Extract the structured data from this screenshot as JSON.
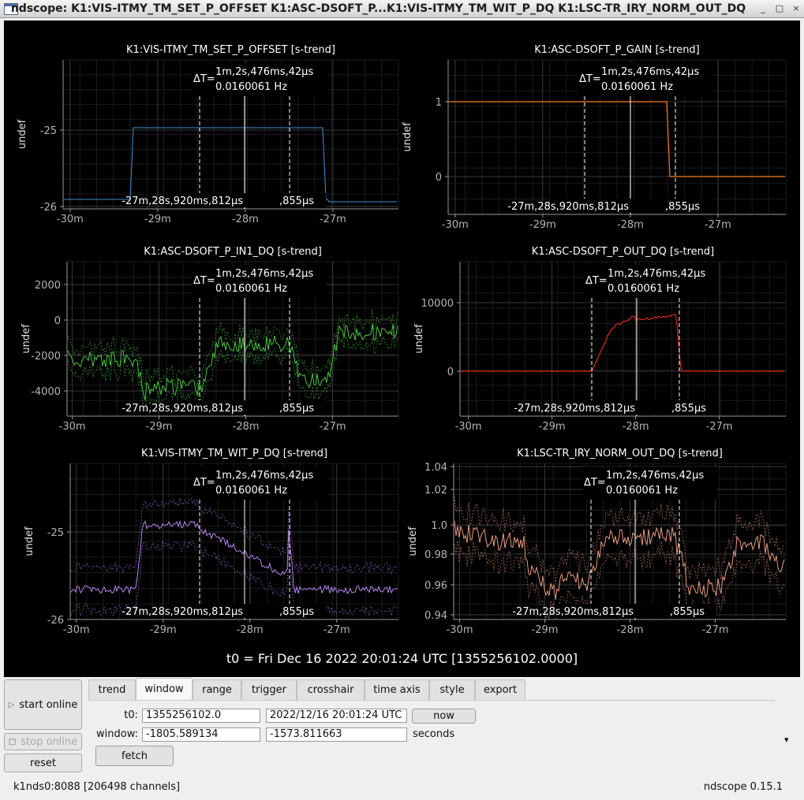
{
  "window": {
    "title": "ndscope: K1:VIS-ITMY_TM_SET_P_OFFSET K1:ASC-DSOFT_P...K1:VIS-ITMY_TM_WIT_P_DQ K1:LSC-TR_IRY_NORM_OUT_DQ",
    "minimize_glyph": "_",
    "maximize_glyph": "□",
    "close_glyph": "×"
  },
  "plots": [
    {
      "title": "K1:VIS-ITMY_TM_SET_P_OFFSET [s-trend]",
      "ylabel": "undef",
      "color": "#3d8fd8",
      "yticks": [
        "-25",
        "-26"
      ],
      "xticks": [
        "-30m",
        "-29m",
        "-28m",
        "-27m"
      ],
      "cursor_delta": "ΔT=",
      "cursor_dt": "1m,2s,476ms,42µs",
      "cursor_freq": "0.0160061 Hz",
      "cursor_t1": "-27m,28s,920ms,812µs",
      "cursor_t2": ",855µs"
    },
    {
      "title": "K1:ASC-DSOFT_P_GAIN [s-trend]",
      "ylabel": "undef",
      "color": "#ff7a1a",
      "yticks": [
        "1",
        "0"
      ],
      "xticks": [
        "-30m",
        "-29m",
        "-28m",
        "-27m"
      ],
      "cursor_delta": "ΔT=",
      "cursor_dt": "1m,2s,476ms,42µs",
      "cursor_freq": "0.0160061 Hz",
      "cursor_t1": "-27m,28s,920ms,812µs",
      "cursor_t2": ",855µs"
    },
    {
      "title": "K1:ASC-DSOFT_P_IN1_DQ [s-trend]",
      "ylabel": "undef",
      "color": "#44c83c",
      "yticks": [
        "2000",
        "0",
        "-2000",
        "-4000"
      ],
      "xticks": [
        "-30m",
        "-29m",
        "-28m",
        "-27m"
      ],
      "cursor_delta": "ΔT=",
      "cursor_dt": "1m,2s,476ms,42µs",
      "cursor_freq": "0.0160061 Hz",
      "cursor_t1": "-27m,28s,920ms,812µs",
      "cursor_t2": ",855µs"
    },
    {
      "title": "K1:ASC-DSOFT_P_OUT_DQ [s-trend]",
      "ylabel": "undef",
      "color": "#e2281c",
      "yticks": [
        "10000",
        "0"
      ],
      "xticks": [
        "-30m",
        "-29m",
        "-28m",
        "-27m"
      ],
      "cursor_delta": "ΔT=",
      "cursor_dt": "1m,2s,476ms,42µs",
      "cursor_freq": "0.0160061 Hz",
      "cursor_t1": "-27m,28s,920ms,812µs",
      "cursor_t2": ",855µs"
    },
    {
      "title": "K1:VIS-ITMY_TM_WIT_P_DQ [s-trend]",
      "ylabel": "undef",
      "color": "#b484ee",
      "yticks": [
        "-25",
        "-26"
      ],
      "xticks": [
        "-30m",
        "-29m",
        "-28m",
        "-27m"
      ],
      "cursor_delta": "ΔT=",
      "cursor_dt": "1m,2s,476ms,42µs",
      "cursor_freq": "0.0160061 Hz",
      "cursor_t1": "-27m,28s,920ms,812µs",
      "cursor_t2": ",855µs"
    },
    {
      "title": "K1:LSC-TR_IRY_NORM_OUT_DQ [s-trend]",
      "ylabel": "undef",
      "color": "#e89a80",
      "yticks": [
        "1.04",
        "1.02",
        "1.0",
        "0.98",
        "0.96",
        "0.94"
      ],
      "xticks": [
        "-30m",
        "-29m",
        "-28m",
        "-27m"
      ],
      "cursor_delta": "ΔT=",
      "cursor_dt": "1m,2s,476ms,42µs",
      "cursor_freq": "0.0160061 Hz",
      "cursor_t1": "-27m,28s,920ms,812µs",
      "cursor_t2": ",855µs"
    }
  ],
  "t0_label": "t0 = Fri Dec 16 2022 20:01:24 UTC [1355256102.0000]",
  "controls": {
    "start_online": "start online",
    "stop_online": "stop online",
    "reset": "reset",
    "tabs": [
      "trend",
      "window",
      "range",
      "trigger",
      "crosshair",
      "time axis",
      "style",
      "export"
    ],
    "active_tab": "window",
    "t0_label": "t0:",
    "t0_gps": "1355256102.0",
    "t0_utc": "2022/12/16 20:01:24 UTC",
    "now_button": "now",
    "window_label": "window:",
    "window_start": "-1805.589134",
    "window_end": "-1573.811663",
    "seconds_label": "seconds",
    "fetch_button": "fetch",
    "collapse_arrow": "▾"
  },
  "status": {
    "server": "k1nds0:8088  [206498 channels]",
    "version": "ndscope 0.15.1"
  }
}
